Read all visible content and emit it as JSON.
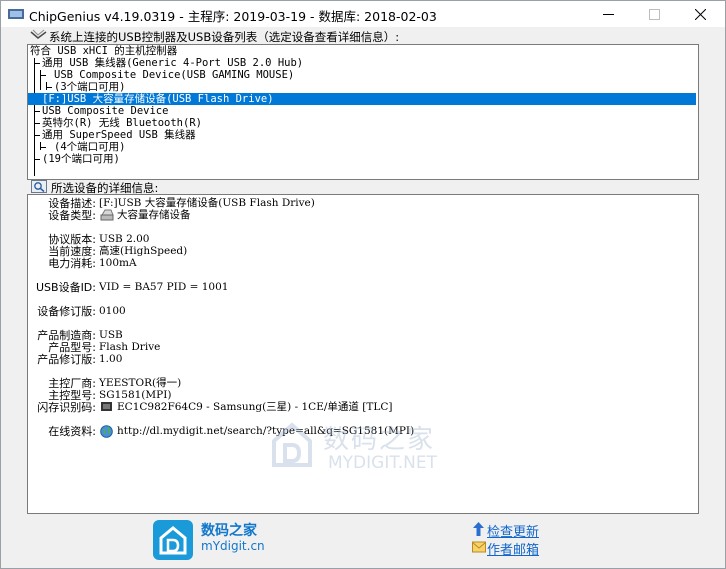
{
  "window": {
    "title": "ChipGenius v4.19.0319 - 主程序: 2019-03-19 - 数据库: 2018-02-03"
  },
  "device_list": {
    "label": "系统上连接的USB控制器及USB设备列表（选定设备查看详细信息）:",
    "rows": [
      "符合 USB xHCI 的主机控制器",
      "通用 USB 集线器(Generic 4-Port USB 2.0 Hub)",
      "USB Composite Device(USB GAMING MOUSE)",
      "(3个端口可用)",
      "[F:]USB 大容量存储设备(USB Flash Drive)",
      "USB Composite Device",
      "英特尔(R) 无线 Bluetooth(R)",
      "通用 SuperSpeed USB 集线器",
      "(4个端口可用)",
      "(19个端口可用)"
    ],
    "selected_index": 4
  },
  "details": {
    "label": "所选设备的详细信息:",
    "rows": [
      {
        "label": "设备描述:",
        "value": "[F:]USB 大容量存储设备(USB Flash Drive)"
      },
      {
        "label": "设备类型:",
        "value": "大容量存储设备"
      },
      {
        "label": "协议版本:",
        "value": "USB 2.00"
      },
      {
        "label": "当前速度:",
        "value": "高速(HighSpeed)"
      },
      {
        "label": "电力消耗:",
        "value": "100mA"
      },
      {
        "label": "USB设备ID:",
        "value": "VID = BA57 PID = 1001"
      },
      {
        "label": "设备修订版:",
        "value": "0100"
      },
      {
        "label": "产品制造商:",
        "value": "USB"
      },
      {
        "label": "产品型号:",
        "value": "Flash Drive"
      },
      {
        "label": "产品修订版:",
        "value": "1.00"
      },
      {
        "label": "主控厂商:",
        "value": "YEESTOR(得一)"
      },
      {
        "label": "主控型号:",
        "value": "SG1581(MPI)"
      },
      {
        "label": "闪存识别码:",
        "value": "EC1C982F64C9 - Samsung(三星) - 1CE/单通道 [TLC]"
      },
      {
        "label": "在线资料:",
        "value": "http://dl.mydigit.net/search/?type=all&q=SG1581(MPI)"
      }
    ]
  },
  "watermark": {
    "cn": "数码之家",
    "en": "MYDIGIT.NET"
  },
  "footer": {
    "site_cn": "数码之家",
    "site_en": "mYdigit.cn",
    "check_update": "检查更新",
    "author_mail": "作者邮箱"
  }
}
